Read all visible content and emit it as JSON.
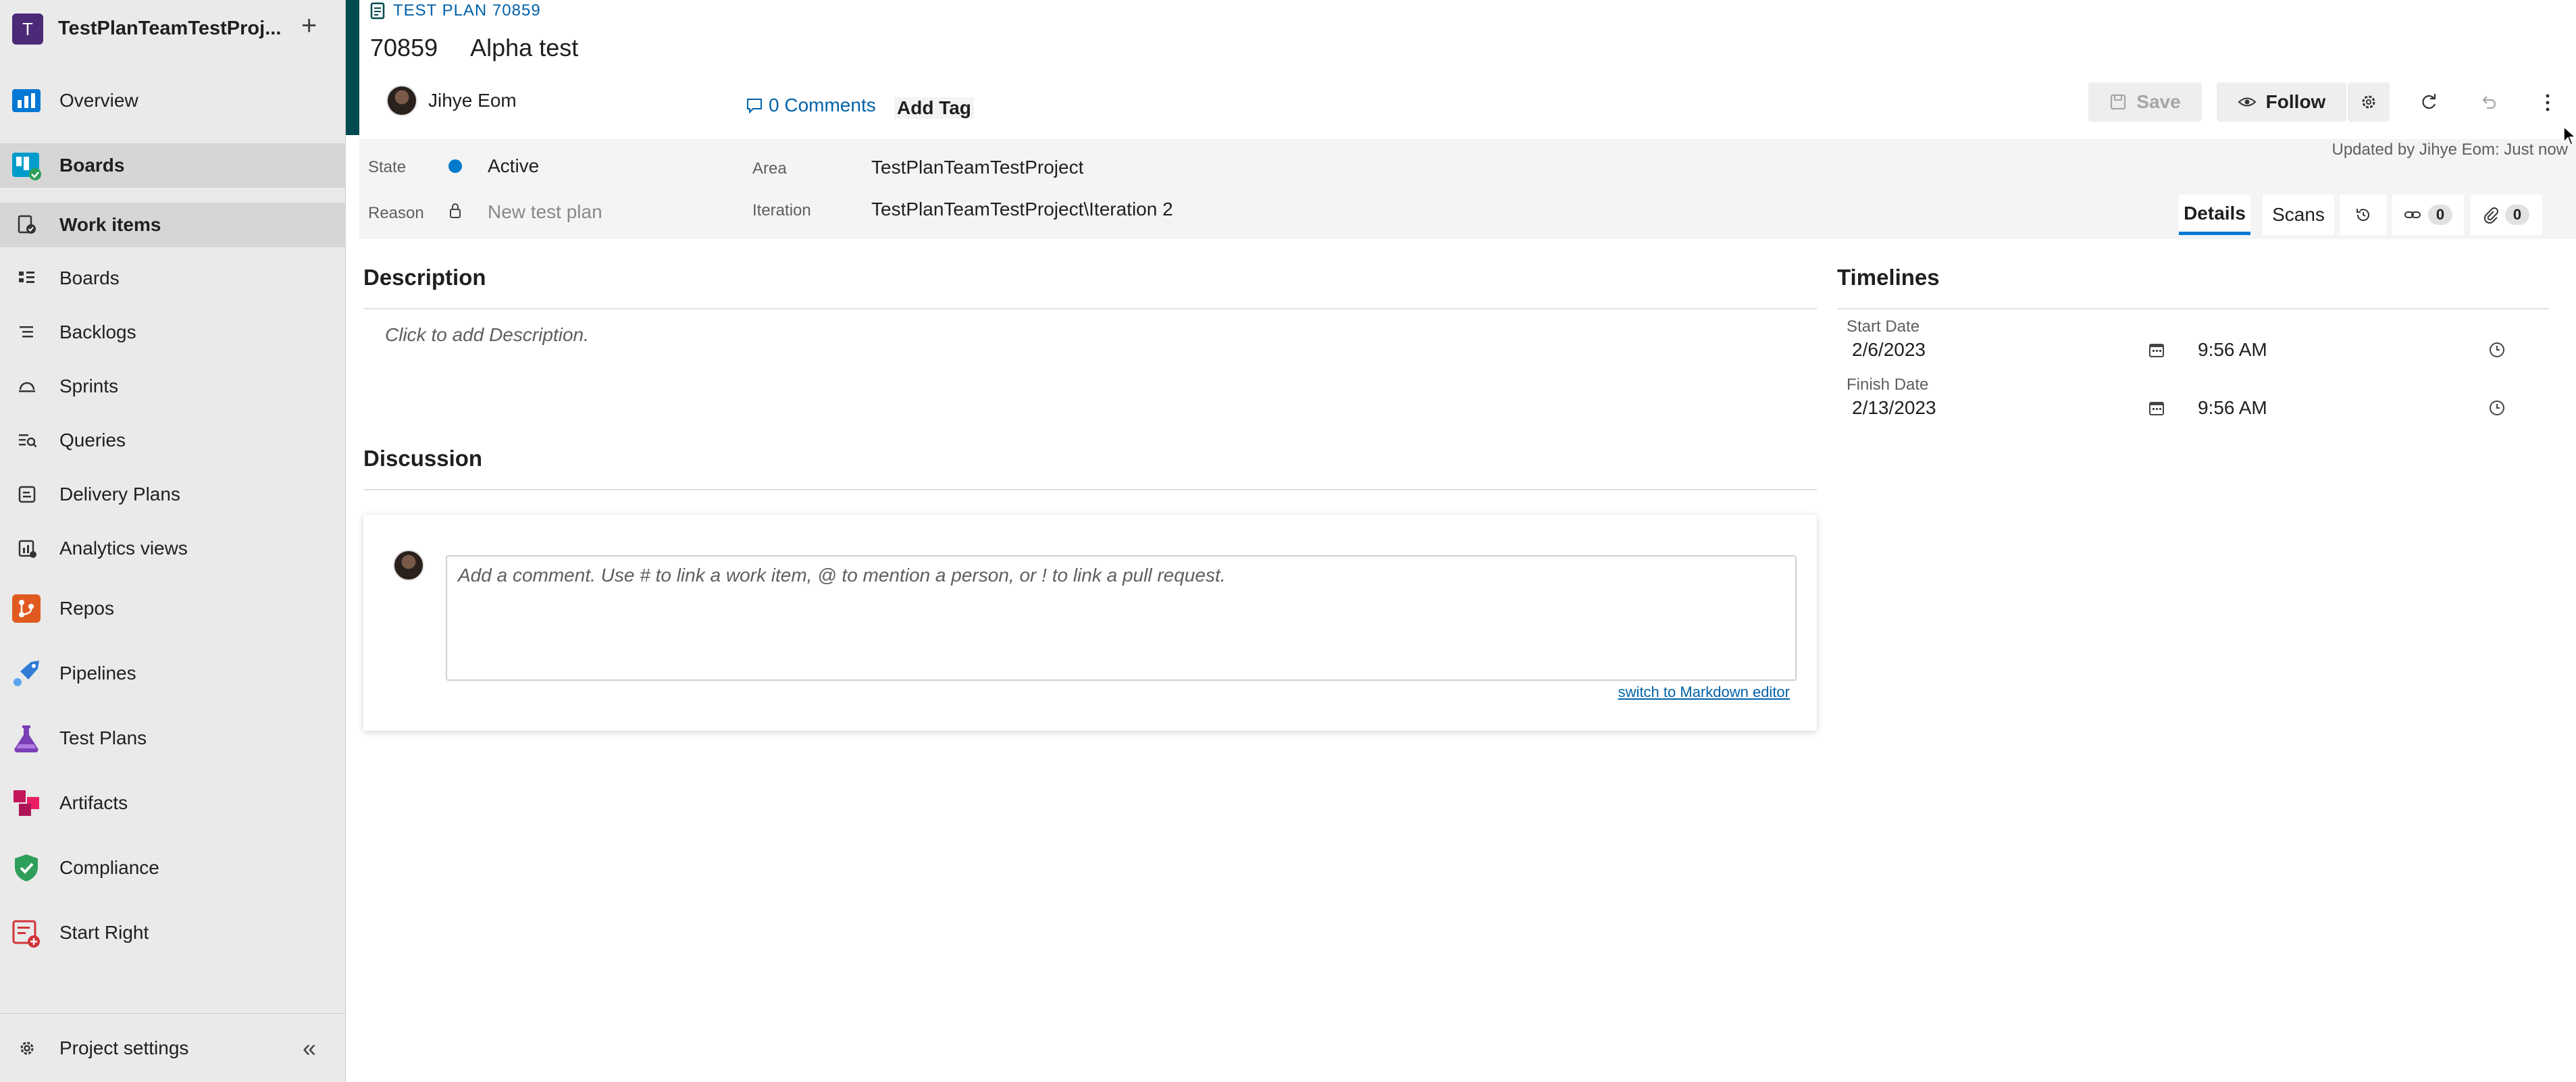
{
  "sidebar": {
    "project_initial": "T",
    "project_name": "TestPlanTeamTestProj...",
    "add_symbol": "+",
    "items": [
      {
        "label": "Overview",
        "icon": "overview-icon",
        "color": "#0078d4"
      },
      {
        "label": "Boards",
        "icon": "boards-icon",
        "color": "#009ccc"
      },
      {
        "label": "Work items",
        "icon": "work-items-icon"
      },
      {
        "label": "Boards",
        "icon": "board-grid-icon"
      },
      {
        "label": "Backlogs",
        "icon": "backlogs-icon"
      },
      {
        "label": "Sprints",
        "icon": "sprints-icon"
      },
      {
        "label": "Queries",
        "icon": "queries-icon"
      },
      {
        "label": "Delivery Plans",
        "icon": "delivery-plans-icon"
      },
      {
        "label": "Analytics views",
        "icon": "analytics-icon"
      },
      {
        "label": "Repos",
        "icon": "repos-icon",
        "color": "#e05a1f"
      },
      {
        "label": "Pipelines",
        "icon": "pipelines-icon",
        "color": "#2f7bd6"
      },
      {
        "label": "Test Plans",
        "icon": "test-plans-icon",
        "color": "#7a3fb7"
      },
      {
        "label": "Artifacts",
        "icon": "artifacts-icon",
        "color": "#c2185b"
      },
      {
        "label": "Compliance",
        "icon": "compliance-icon",
        "color": "#2e9e5b"
      },
      {
        "label": "Start Right",
        "icon": "start-right-icon",
        "color": "#d13438"
      }
    ],
    "settings_label": "Project settings",
    "collapse_symbol": "«"
  },
  "work_item": {
    "type_label": "TEST PLAN 70859",
    "id": "70859",
    "title": "Alpha test",
    "assignee": "Jihye Eom",
    "comments_label": "0 Comments",
    "add_tag_label": "Add Tag",
    "updated_text": "Updated by Jihye Eom: Just now"
  },
  "toolbar": {
    "save_label": "Save",
    "follow_label": "Follow"
  },
  "fields": {
    "state_label": "State",
    "state_value": "Active",
    "state_color": "#007acc",
    "reason_label": "Reason",
    "reason_placeholder": "New test plan",
    "area_label": "Area",
    "area_value": "TestPlanTeamTestProject",
    "iteration_label": "Iteration",
    "iteration_value": "TestPlanTeamTestProject\\Iteration 2"
  },
  "tabs": {
    "details": "Details",
    "scans": "Scans",
    "links_count": "0",
    "attachments_count": "0"
  },
  "description": {
    "title": "Description",
    "placeholder": "Click to add Description."
  },
  "discussion": {
    "title": "Discussion",
    "placeholder": "Add a comment. Use # to link a work item, @ to mention a person, or ! to link a pull request.",
    "markdown_link": "switch to Markdown editor"
  },
  "timelines": {
    "title": "Timelines",
    "start_label": "Start Date",
    "start_date": "2/6/2023",
    "start_time": "9:56 AM",
    "finish_label": "Finish Date",
    "finish_date": "2/13/2023",
    "finish_time": "9:56 AM"
  },
  "colors": {
    "accent_bar": "#004b50",
    "link": "#0062a8",
    "selected_tab": "#0078d4"
  }
}
